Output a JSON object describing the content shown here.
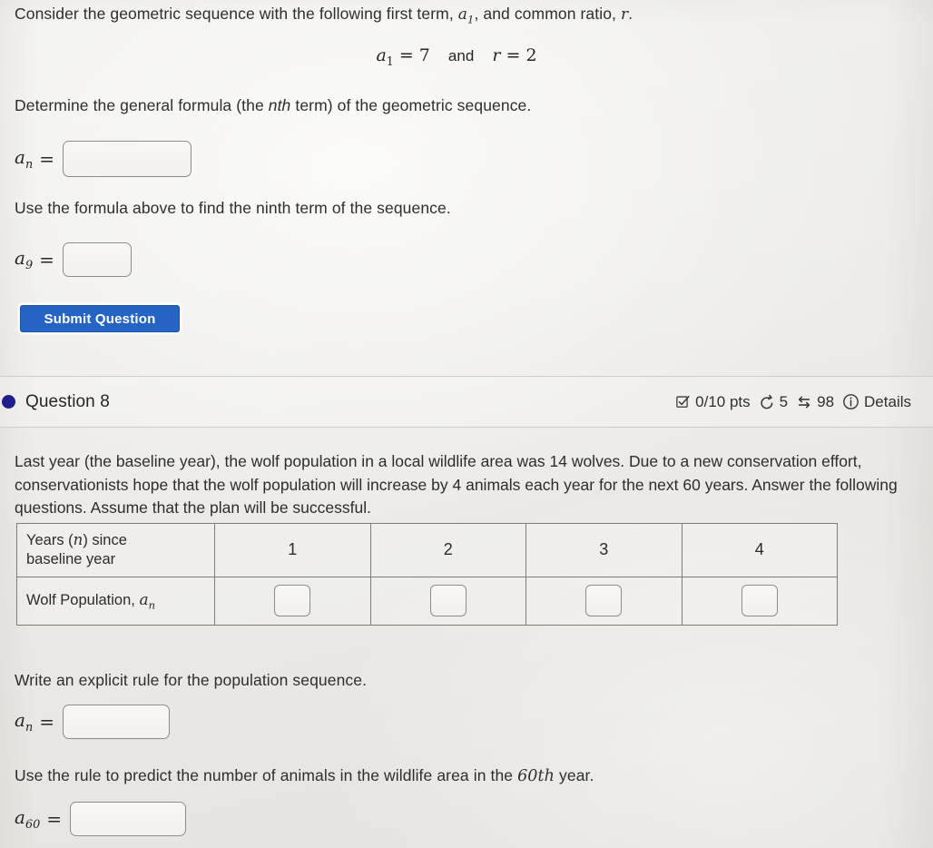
{
  "question7": {
    "intro_before": "Consider the geometric sequence with the following first term, ",
    "intro_var1": "a",
    "intro_var1_sub": "1",
    "intro_middle": ", and common ratio, ",
    "intro_var2": "r",
    "intro_end": ".",
    "given_a1_label": "a",
    "given_a1_sub": "1",
    "given_a1_eq": "= 7",
    "given_and": "and",
    "given_r_label": "r",
    "given_r_eq": "= 2",
    "determine_text_before": "Determine the general formula (the ",
    "determine_nth": "nth",
    "determine_text_after": " term) of the geometric sequence.",
    "an_label": "a",
    "an_sub": "n",
    "equals": "=",
    "an_value": "",
    "an_placeholder": "",
    "use_formula_text": "Use the formula above to find the ninth term of the sequence.",
    "a9_label": "a",
    "a9_sub": "9",
    "a9_value": "",
    "a9_placeholder": "",
    "submit_label": "Submit Question"
  },
  "question8": {
    "title": "Question 8",
    "status_dot_color": "#1f1f8c",
    "badges": {
      "points": "0/10 pts",
      "attempts": "5",
      "views": "98",
      "details": "Details"
    },
    "icons": {
      "points": "checkbox-check-icon",
      "attempts": "undo-arrow-icon",
      "views": "swap-arrows-icon",
      "details": "info-circle-icon"
    },
    "paragraph": "Last year (the baseline year), the wolf population in a local wildlife area was 14 wolves. Due to a new conservation effort, conservationists hope that the wolf population will increase by 4 animals each year for the next 60 years. Answer the following questions. Assume that the plan will be successful.",
    "table": {
      "row1_label_line1": "Years (n) since",
      "row1_label_line2": "baseline year",
      "row1_label_var": "n",
      "row2_label_text": "Wolf Population, ",
      "row2_label_var": "a",
      "row2_label_sub": "n",
      "years": [
        "1",
        "2",
        "3",
        "4"
      ],
      "population_values": [
        "",
        "",
        "",
        ""
      ],
      "population_placeholder": ""
    },
    "explicit_rule_text": "Write an explicit rule for the population sequence.",
    "an_label": "a",
    "an_sub": "n",
    "equals": "=",
    "an_value": "",
    "an_placeholder": "",
    "predict_text_before": "Use the rule to predict the number of animals in the wildlife area in the ",
    "predict_ordinal": "60th",
    "predict_text_after": " year.",
    "a60_label": "a",
    "a60_sub": "60",
    "a60_value": "",
    "a60_placeholder": ""
  },
  "colors": {
    "submit_button": "#2563c4",
    "status_dot": "#1f1f8c",
    "page_background": "#eeedea",
    "border": "#8e8b88"
  }
}
